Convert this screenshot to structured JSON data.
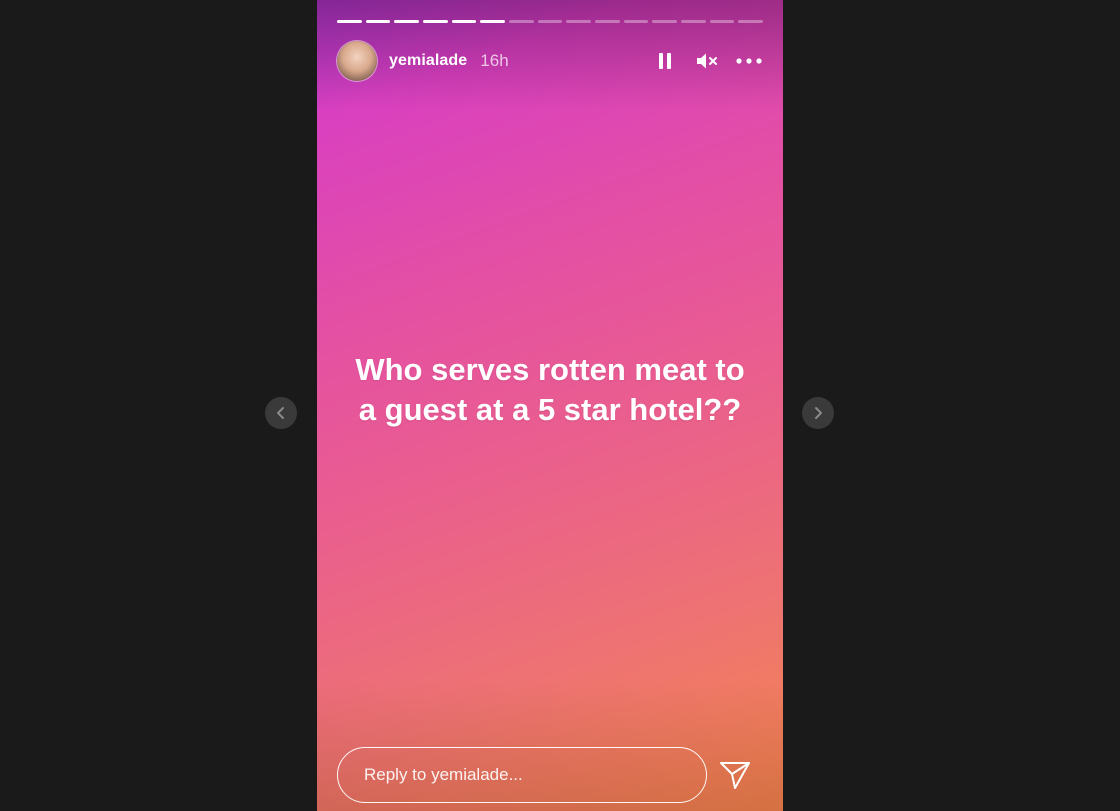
{
  "story": {
    "username": "yemialade",
    "time_ago": "16h",
    "text": "Who serves rotten meat to a guest at a 5 star hotel??",
    "progress": {
      "total_segments": 15,
      "completed_segments": 6
    }
  },
  "header_icons": {
    "pause": "pause-icon",
    "mute": "mute-icon",
    "more": "more-options-icon"
  },
  "reply": {
    "placeholder": "Reply to yemialade...",
    "send_icon": "send-icon"
  },
  "navigation": {
    "prev_icon": "chevron-left-icon",
    "next_icon": "chevron-right-icon"
  },
  "colors": {
    "page_background": "#1a1a1a",
    "gradient_top": "#b53ad2",
    "gradient_middle": "#e34ea6",
    "gradient_bottom": "#f4864e",
    "text": "#ffffff"
  }
}
